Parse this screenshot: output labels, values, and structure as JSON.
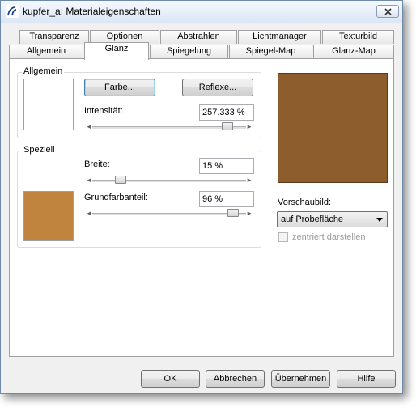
{
  "window": {
    "title": "kupfer_a: Materialeigenschaften",
    "close_icon": "close-icon"
  },
  "tabs": {
    "row1": [
      "Transparenz",
      "Optionen",
      "Abstrahlen",
      "Lichtmanager",
      "Texturbild"
    ],
    "row2": [
      "Allgemein",
      "Glanz",
      "Spiegelung",
      "Spiegel-Map",
      "Glanz-Map"
    ],
    "active": "Glanz"
  },
  "allgemein": {
    "group_label": "Allgemein",
    "farbe_button": "Farbe...",
    "reflexe_button": "Reflexe...",
    "intensitaet_label": "Intensität:",
    "intensitaet_value": "257.333 %",
    "intensitaet_slider": 0.92,
    "swatch_color": "#ffffff"
  },
  "speziell": {
    "group_label": "Speziell",
    "breite_label": "Breite:",
    "breite_value": "15 %",
    "breite_slider": 0.15,
    "grundfarbanteil_label": "Grundfarbanteil:",
    "grundfarbanteil_value": "96 %",
    "grundfarbanteil_slider": 0.96,
    "swatch_color": "#c1843f"
  },
  "preview": {
    "color": "#8e5d2e",
    "label": "Vorschaubild:",
    "select_value": "auf Probefläche",
    "center_label": "zentriert darstellen",
    "center_checked": false
  },
  "footer": {
    "ok": "OK",
    "cancel": "Abbrechen",
    "apply": "Übernehmen",
    "help": "Hilfe"
  }
}
